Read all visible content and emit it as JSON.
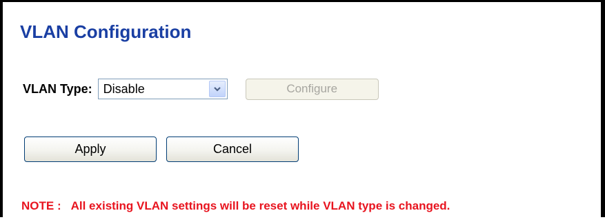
{
  "page": {
    "title": "VLAN Configuration"
  },
  "vlan": {
    "type_label": "VLAN Type:",
    "selected": "Disable",
    "configure_label": "Configure"
  },
  "actions": {
    "apply_label": "Apply",
    "cancel_label": "Cancel"
  },
  "note": {
    "prefix": "NOTE :",
    "text": "All existing VLAN settings will be reset while VLAN type is changed."
  },
  "colors": {
    "title": "#1a3fa3",
    "note": "#e8141f",
    "button_border": "#003c74"
  },
  "icons": {
    "dropdown": "chevron-down-icon"
  }
}
